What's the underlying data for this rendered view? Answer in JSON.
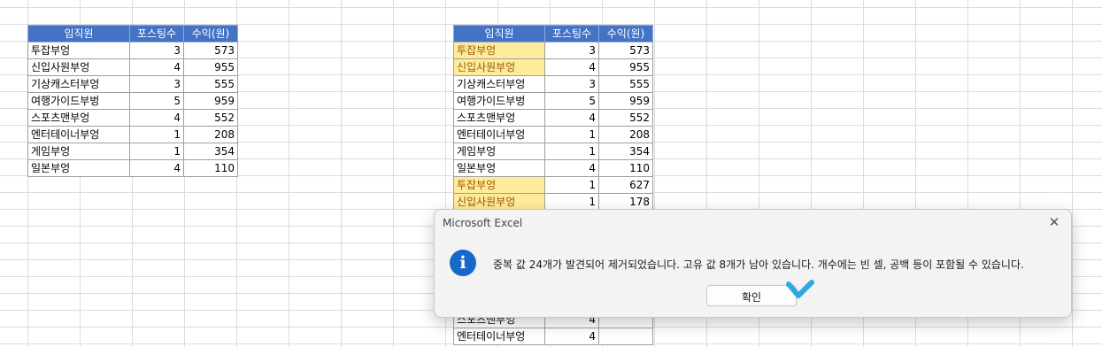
{
  "headers": [
    "임직원",
    "포스팅수",
    "수익(원)"
  ],
  "left_table": {
    "rows": [
      {
        "name": "투잡부엉",
        "posts": "3",
        "revenue": "573"
      },
      {
        "name": "신입사원부엉",
        "posts": "4",
        "revenue": "955"
      },
      {
        "name": "기상캐스터부엉",
        "posts": "3",
        "revenue": "555"
      },
      {
        "name": "여행가이드부벙",
        "posts": "5",
        "revenue": "959"
      },
      {
        "name": "스포츠맨부엉",
        "posts": "4",
        "revenue": "552"
      },
      {
        "name": "엔터테이너부엉",
        "posts": "1",
        "revenue": "208"
      },
      {
        "name": "게임부엉",
        "posts": "1",
        "revenue": "354"
      },
      {
        "name": "일본부엉",
        "posts": "4",
        "revenue": "110"
      }
    ]
  },
  "right_table": {
    "rows": [
      {
        "name": "투잡부엉",
        "posts": "3",
        "revenue": "573",
        "duplicate": true
      },
      {
        "name": "신입사원부엉",
        "posts": "4",
        "revenue": "955",
        "duplicate": true
      },
      {
        "name": "기상캐스터부엉",
        "posts": "3",
        "revenue": "555",
        "duplicate": false
      },
      {
        "name": "여행가이드부벙",
        "posts": "5",
        "revenue": "959",
        "duplicate": false
      },
      {
        "name": "스포츠맨부엉",
        "posts": "4",
        "revenue": "552",
        "duplicate": false
      },
      {
        "name": "엔터테이너부엉",
        "posts": "1",
        "revenue": "208",
        "duplicate": false
      },
      {
        "name": "게임부엉",
        "posts": "1",
        "revenue": "354",
        "duplicate": false
      },
      {
        "name": "일본부엉",
        "posts": "4",
        "revenue": "110",
        "duplicate": false
      },
      {
        "name": "투잡부엉",
        "posts": "1",
        "revenue": "627",
        "duplicate": true
      },
      {
        "name": "신입사원부엉",
        "posts": "1",
        "revenue": "178",
        "duplicate": true
      }
    ],
    "bottom_rows": [
      {
        "name": "스포츠맨부엉",
        "posts": "4",
        "revenue": ""
      },
      {
        "name": "엔터테이너부엉",
        "posts": "4",
        "revenue": ""
      }
    ]
  },
  "dialog": {
    "title": "Microsoft Excel",
    "close_glyph": "✕",
    "icon_glyph": "i",
    "icon": "info-icon",
    "message": "중복 값 24개가 발견되어 제거되었습니다. 고유 값 8개가 남아 있습니다. 개수에는 빈 셀, 공백 등이 포함될 수 있습니다.",
    "ok_label": "확인"
  },
  "colors": {
    "header_bg": "#4472c4",
    "duplicate_fill": "#ffeb9c",
    "duplicate_text": "#9c5700",
    "info_icon": "#1769c7",
    "cursor": "#2fa8e0"
  }
}
